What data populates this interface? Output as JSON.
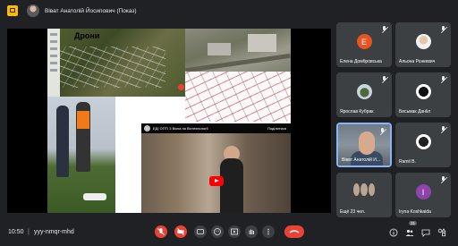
{
  "header": {
    "presenter_name": "Віват Анатолій Йосипович (Показ)"
  },
  "slide": {
    "title": "Дрони"
  },
  "video": {
    "title": "ЕДІ ОПТІ 3 Вікна на біотехнології",
    "share_label": "Поділитися"
  },
  "participants": [
    {
      "name": "Елена Домбровська",
      "avatar_letter": "E",
      "avatar_color": "#e8531f"
    },
    {
      "name": "Альона Рєнкевич",
      "avatar_letter": "",
      "avatar_color": "#f2f2f2"
    },
    {
      "name": "Ярослав Кубрак",
      "avatar_letter": "",
      "avatar_color": "#c9d6de"
    },
    {
      "name": "Бисьмак Данііл",
      "avatar_letter": "",
      "avatar_color": "#ffffff"
    },
    {
      "name": "Віват Анатолій Й...",
      "avatar_letter": "",
      "avatar_color": ""
    },
    {
      "name": "Ramil B.",
      "avatar_letter": "",
      "avatar_color": "#ffffff"
    },
    {
      "name": "Ещё 23 чел.",
      "avatar_letter": "",
      "avatar_color": ""
    },
    {
      "name": "Iryna Koshkaida",
      "avatar_letter": "I",
      "avatar_color": "#8e44ad"
    }
  ],
  "footer": {
    "time": "10:50",
    "divider": "|",
    "meeting_code": "yyy-nmqr-mhd",
    "participant_count": "31"
  },
  "colors": {
    "leave": "#ea4335",
    "muted": "#ea4335",
    "background": "#202124",
    "active_border": "#8ab4f8"
  }
}
